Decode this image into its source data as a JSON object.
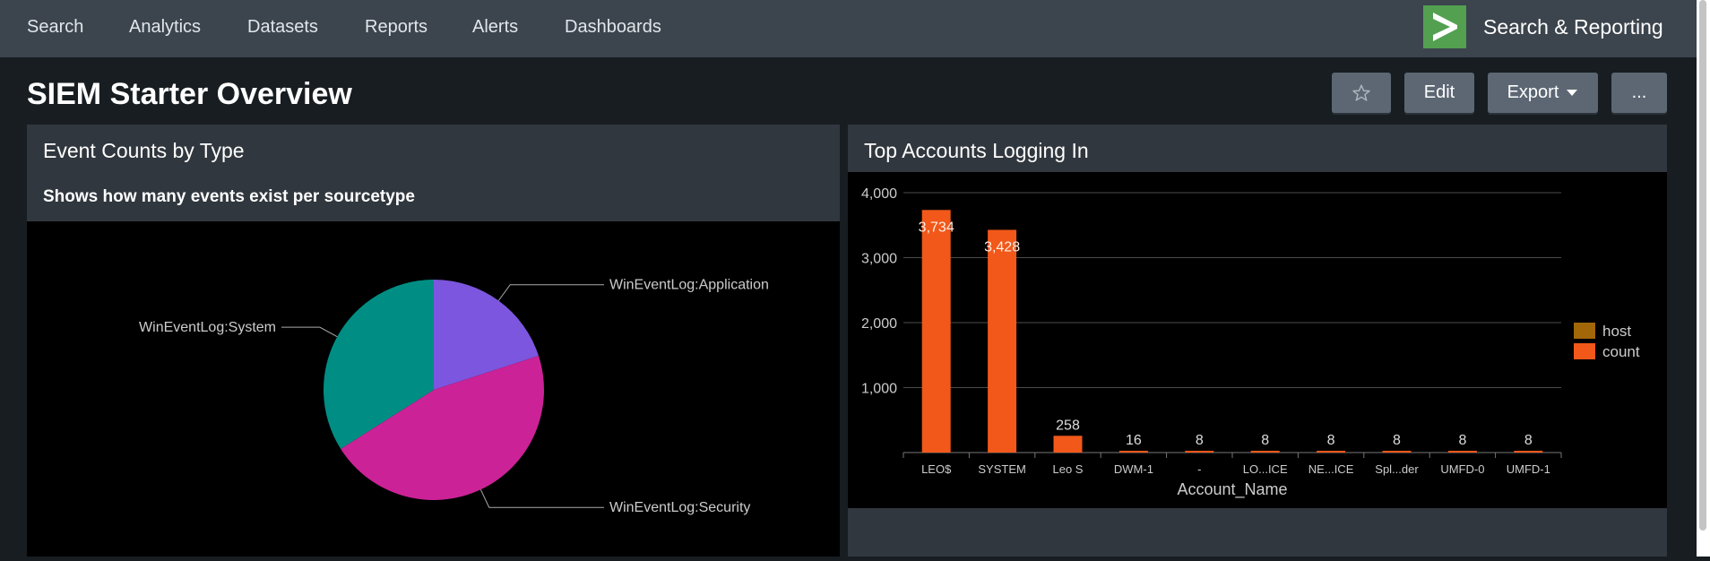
{
  "nav": {
    "items": [
      "Search",
      "Analytics",
      "Datasets",
      "Reports",
      "Alerts",
      "Dashboards"
    ],
    "app_title": "Search & Reporting",
    "logo_icon": "splunk-chevron-logo"
  },
  "page": {
    "title": "SIEM Starter Overview"
  },
  "toolbar": {
    "favorite_icon": "star-icon",
    "edit_label": "Edit",
    "export_label": "Export",
    "more_label": "..."
  },
  "panels": {
    "event_counts": {
      "title": "Event Counts by Type",
      "description": "Shows how many events exist per sourcetype"
    },
    "top_accounts": {
      "title": "Top Accounts Logging In"
    }
  },
  "colors": {
    "application": "#7c56de",
    "security": "#cc2297",
    "system": "#008e84",
    "host": "#a16708",
    "count": "#f1581a"
  },
  "chart_data": [
    {
      "type": "pie",
      "labels": [
        "WinEventLog:Application",
        "WinEventLog:Security",
        "WinEventLog:System"
      ],
      "values": [
        20,
        46,
        34
      ]
    },
    {
      "type": "bar",
      "categories": [
        "LEO$",
        "SYSTEM",
        "Leo S",
        "DWM-1",
        "-",
        "LO...ICE",
        "NE...ICE",
        "Spl...der",
        "UMFD-0",
        "UMFD-1"
      ],
      "series": [
        {
          "name": "host",
          "values": [
            0,
            0,
            0,
            0,
            0,
            0,
            0,
            0,
            0,
            0
          ]
        },
        {
          "name": "count",
          "values": [
            3734,
            3428,
            258,
            16,
            8,
            8,
            8,
            8,
            8,
            8
          ]
        }
      ],
      "data_labels": [
        "3,734",
        "3,428",
        "258",
        "16",
        "8",
        "8",
        "8",
        "8",
        "8",
        "8"
      ],
      "yticks": [
        "4,000",
        "3,000",
        "2,000",
        "1,000"
      ],
      "ytick_values": [
        4000,
        3000,
        2000,
        1000
      ],
      "ylim": [
        0,
        4000
      ],
      "xlabel": "Account_Name",
      "legend": "right",
      "grid": true
    }
  ]
}
